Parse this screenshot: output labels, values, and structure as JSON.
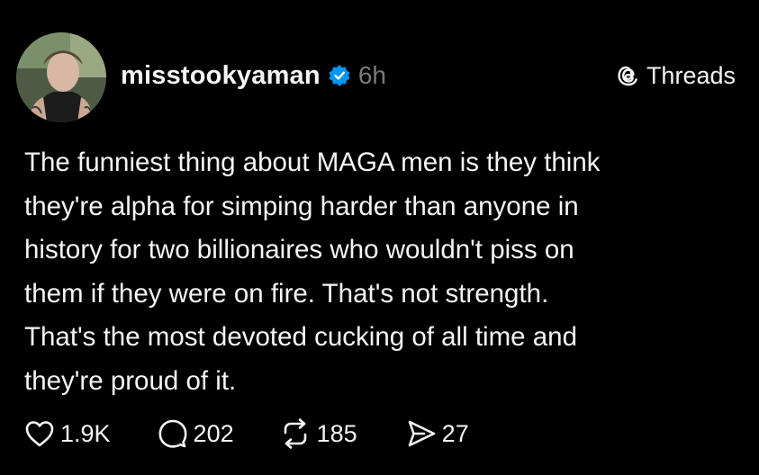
{
  "post": {
    "author": {
      "username": "misstookyaman",
      "verified": true
    },
    "time_ago": "6h",
    "brand": {
      "label": "Threads",
      "icon": "threads-logo-icon"
    },
    "text": "The funniest thing about MAGA men is they think\nthey're alpha for simping harder than anyone in\nhistory for two billionaires who wouldn't piss on\nthem if they were on fire. That's not strength.\nThat's the most devoted cucking of all time and\nthey're proud of it.",
    "actions": {
      "likes": "1.9K",
      "replies": "202",
      "reposts": "185",
      "shares": "27"
    }
  },
  "colors": {
    "background": "#000000",
    "text": "#f3f5f7",
    "muted": "#7a7a7a",
    "verified_badge": "#0095f6"
  }
}
